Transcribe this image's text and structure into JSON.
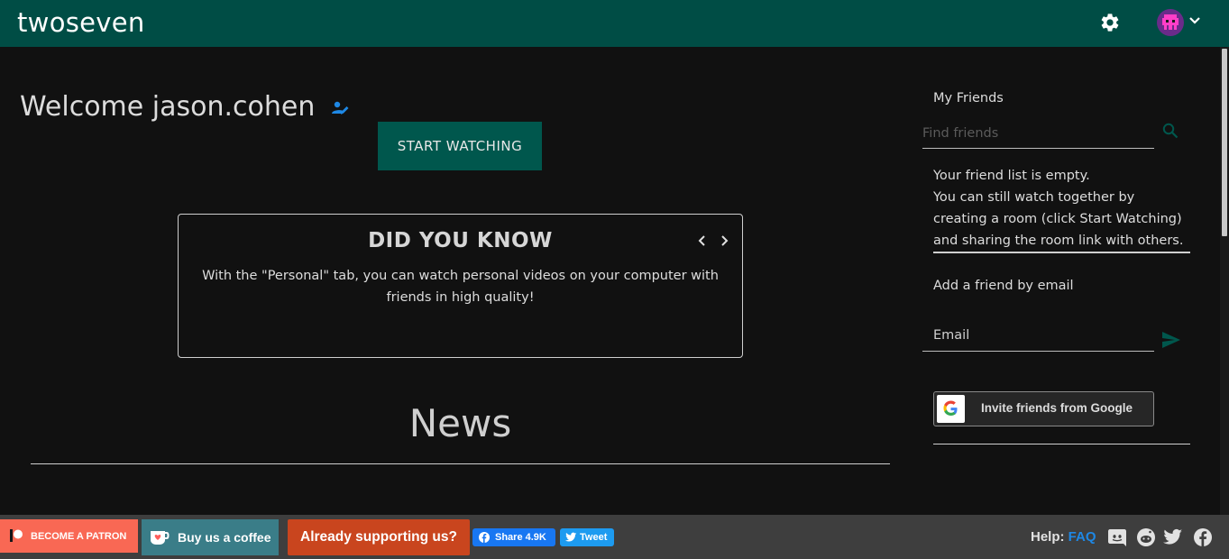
{
  "header": {
    "brand": "twoseven",
    "settings_icon": "gear-icon",
    "avatar_icon": "alien-avatar-icon",
    "menu_icon": "chevron-down-icon"
  },
  "main": {
    "welcome": "Welcome jason.cohen",
    "start_watching": "START WATCHING",
    "did_you_know": {
      "title": "DID YOU KNOW",
      "text": "With the \"Personal\" tab, you can watch personal videos on your computer with friends in high quality!"
    },
    "news_title": "News"
  },
  "sidebar": {
    "friends_title": "My Friends",
    "find_placeholder": "Find friends",
    "empty_line1": "Your friend list is empty.",
    "empty_line2": "You can still watch together by creating a room (click Start Watching) and sharing the room link with others.",
    "add_friend_title": "Add a friend by email",
    "email_placeholder": "Email",
    "google_invite": "Invite friends from Google"
  },
  "footer": {
    "patron": "BECOME A PATRON",
    "coffee": "Buy us a coffee",
    "supporting": "Already supporting us?",
    "fb_share": "Share 4.9K",
    "tweet": "Tweet",
    "help_label": "Help:",
    "faq": "FAQ"
  },
  "colors": {
    "brand": "#004d45",
    "accent": "#00574d",
    "icon_accent": "#1e88e5",
    "patron": "#f96854",
    "coffee": "#3a7d88",
    "supporting": "#c9451e"
  }
}
